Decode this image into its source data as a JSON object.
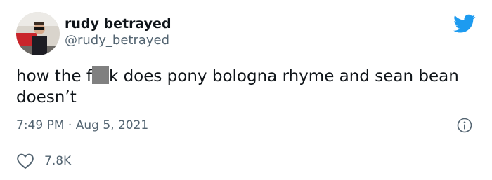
{
  "author": {
    "display_name": "rudy betrayed",
    "handle": "@rudy_betrayed"
  },
  "tweet": {
    "text_before": "how the f",
    "text_after": "k does pony bologna rhyme and sean bean doesn’t",
    "time": "7:49 PM",
    "separator": "·",
    "date": "Aug 5, 2021",
    "likes": "7.8K"
  },
  "icons": {
    "brand": "twitter-bird-icon",
    "info": "info-icon",
    "like": "heart-icon"
  },
  "colors": {
    "brand": "#1d9bf0",
    "text": "#0f1419",
    "secondary": "#536471",
    "divider": "#cfd9de",
    "censor": "#808080"
  }
}
